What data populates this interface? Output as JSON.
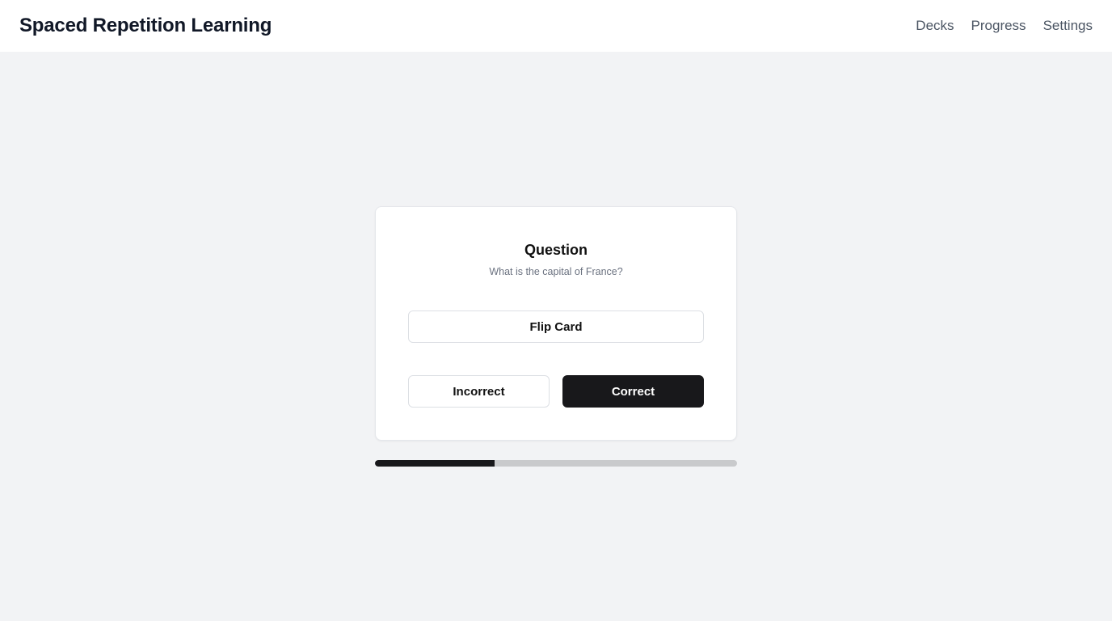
{
  "header": {
    "title": "Spaced Repetition Learning",
    "nav": [
      {
        "label": "Decks"
      },
      {
        "label": "Progress"
      },
      {
        "label": "Settings"
      }
    ]
  },
  "card": {
    "heading": "Question",
    "question": "What is the capital of France?",
    "flip_label": "Flip Card",
    "incorrect_label": "Incorrect",
    "correct_label": "Correct"
  },
  "progress": {
    "fraction": 0.33
  },
  "colors": {
    "background": "#f2f3f5",
    "accent": "#18181b",
    "track": "#c9cacc"
  }
}
